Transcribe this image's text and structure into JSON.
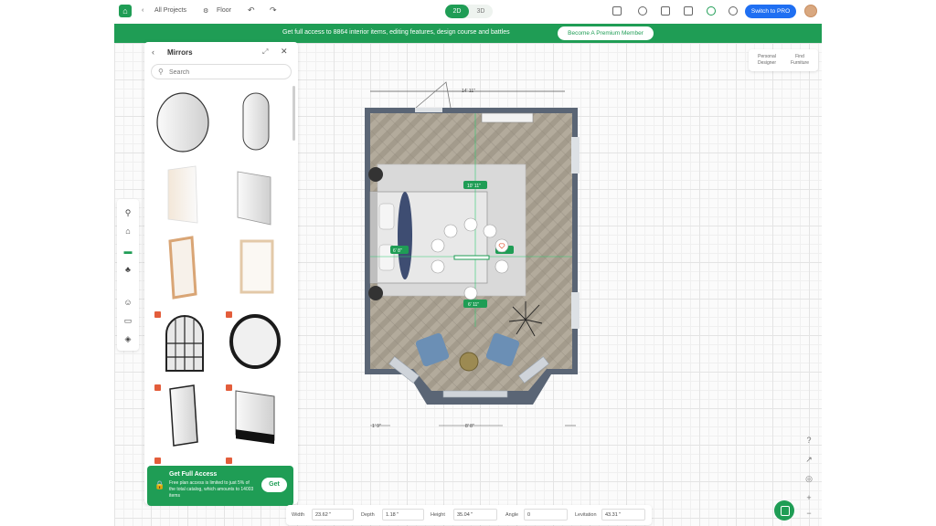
{
  "topbar": {
    "all_projects": "All Projects",
    "floor": "Floor",
    "mode_2d": "2D",
    "mode_3d": "3D",
    "pro_button": "Switch to PRO"
  },
  "banner": {
    "text": "Get full access to 8864 interior items, editing features, design course and battles",
    "button": "Become A Premium Member"
  },
  "panel": {
    "title": "Mirrors",
    "search_placeholder": "Search"
  },
  "access_card": {
    "title": "Get Full Access",
    "description": "Free plan access is limited to just 5% of the total catalog, which amounts to 14003 items",
    "button": "Get"
  },
  "right_menu": {
    "item1_line1": "Personal",
    "item1_line2": "Designer",
    "item2_line1": "Find",
    "item2_line2": "Furniture"
  },
  "plan": {
    "overall_width": "14' 11\"",
    "dim_rug_top": "10' 11\"",
    "dim_left": "6' 8\"",
    "dim_right": "5' 2\"",
    "dim_bottom": "6' 11\"",
    "dim_bottom_left": "1' 9\"",
    "dim_bottom_center": "8' 8\""
  },
  "dimensions": {
    "width_label": "Width",
    "width_value": "23.62 \"",
    "depth_label": "Depth",
    "depth_value": "1.18 \"",
    "height_label": "Height",
    "height_value": "35.04 \"",
    "angle_label": "Angle",
    "angle_value": "0",
    "levitation_label": "Levitation",
    "levitation_value": "43.31 \""
  },
  "colors": {
    "accent": "#1f9d55",
    "pro": "#1f6ff2",
    "wall": "#5a6575",
    "lock": "#e35d3b"
  }
}
